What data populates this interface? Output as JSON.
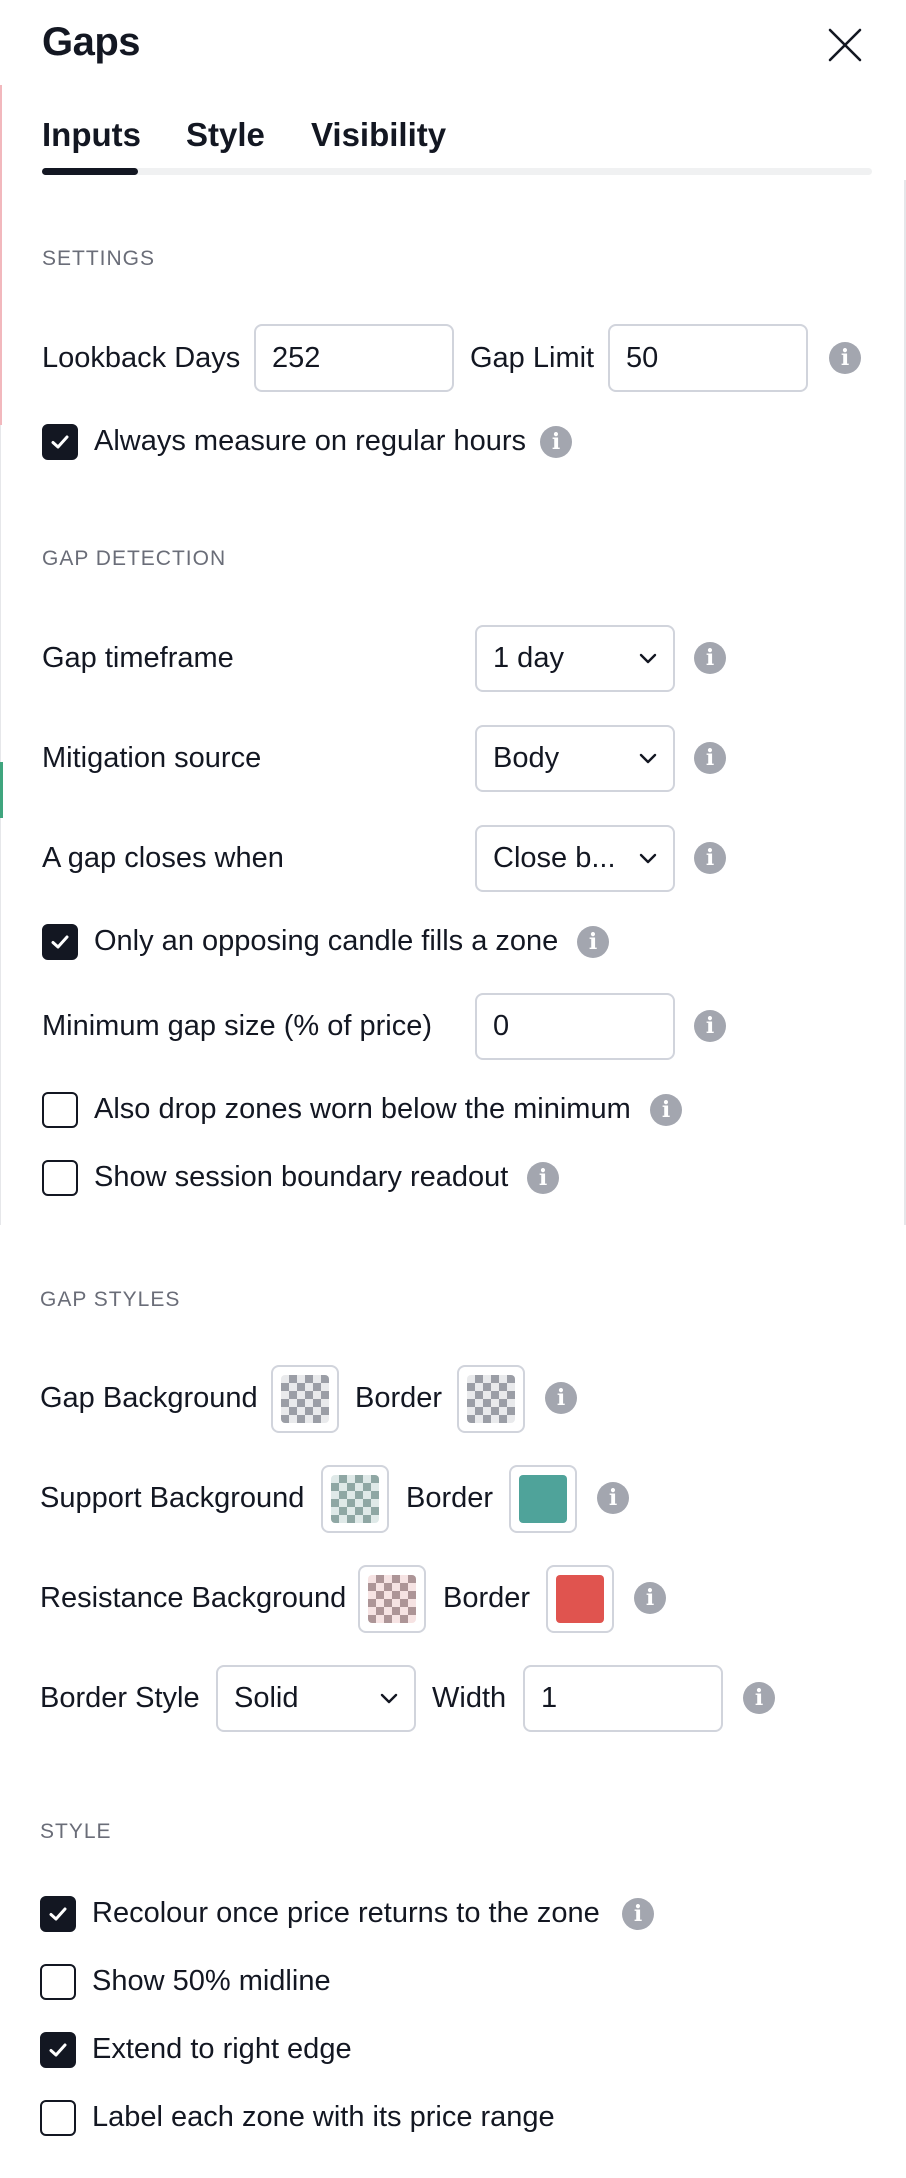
{
  "dialog": {
    "title": "Gaps"
  },
  "tabs": [
    {
      "label": "Inputs",
      "active": true
    },
    {
      "label": "Style",
      "active": false
    },
    {
      "label": "Visibility",
      "active": false
    }
  ],
  "settings": {
    "section_label": "SETTINGS",
    "lookback_label": "Lookback Days",
    "lookback_value": "252",
    "gap_limit_label": "Gap Limit",
    "gap_limit_value": "50",
    "regular_hours_label": "Always measure on regular hours",
    "regular_hours_checked": true
  },
  "gap_detection": {
    "section_label": "GAP DETECTION",
    "timeframe_label": "Gap timeframe",
    "timeframe_value": "1 day",
    "mitigation_label": "Mitigation source",
    "mitigation_value": "Body",
    "closes_label": "A gap closes when",
    "closes_value": "Close b...",
    "opposing_label": "Only an opposing candle fills a zone",
    "opposing_checked": true,
    "min_size_label": "Minimum gap size (% of price)",
    "min_size_value": "0",
    "drop_worn_label": "Also drop zones worn below the minimum",
    "drop_worn_checked": false,
    "session_label": "Show session boundary readout",
    "session_checked": false
  },
  "gap_styles": {
    "section_label": "GAP STYLES",
    "gap_bg_label": "Gap Background",
    "border_label": "Border",
    "support_bg_label": "Support Background",
    "resistance_bg_label": "Resistance Background",
    "border_style_label": "Border Style",
    "border_style_value": "Solid",
    "width_label": "Width",
    "width_value": "1",
    "colors": {
      "support_border": "#4fa39a",
      "resistance_border": "#e0544f",
      "support_tint": "#4fa39a",
      "resistance_tint": "#d05a5a"
    }
  },
  "style": {
    "section_label": "STYLE",
    "recolour_label": "Recolour once price returns to the zone",
    "recolour_checked": true,
    "midline_label": "Show 50% midline",
    "midline_checked": false,
    "extend_label": "Extend to right edge",
    "extend_checked": true,
    "price_range_label": "Label each zone with its price range",
    "price_range_checked": false
  },
  "icons": {
    "close": "close-icon",
    "info": "info-icon",
    "chevron": "chevron-down-icon",
    "check": "checkmark-icon"
  }
}
